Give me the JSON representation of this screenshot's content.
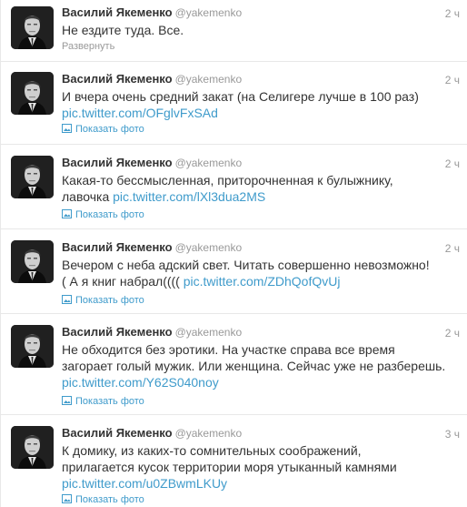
{
  "tweets": [
    {
      "name": "Василий Якеменко",
      "handle": "@yakemenko",
      "time": "2 ч",
      "lines": [
        "Не ездите туда. Все."
      ],
      "link": "",
      "action": "Развернуть",
      "action_type": "expand"
    },
    {
      "name": "Василий Якеменко",
      "handle": "@yakemenko",
      "time": "2 ч",
      "lines": [
        "И вчера  очень средний закат (на Селигере лучше в 100 раз)"
      ],
      "link": "pic.twitter.com/OFglvFxSAd",
      "action": "Показать фото",
      "action_type": "photo"
    },
    {
      "name": "Василий Якеменко",
      "handle": "@yakemenko",
      "time": "2 ч",
      "lines": [
        "Какая-то бессмысленная, приторочненная к булыжнику,",
        "лавочка "
      ],
      "link": "pic.twitter.com/lXl3dua2MS",
      "action": "Показать фото",
      "action_type": "photo"
    },
    {
      "name": "Василий Якеменко",
      "handle": "@yakemenko",
      "time": "2 ч",
      "lines": [
        "Вечером с неба адский свет. Читать совершенно невозможно!",
        "( А я книг набрал(((( "
      ],
      "link": "pic.twitter.com/ZDhQofQvUj",
      "action": "Показать фото",
      "action_type": "photo"
    },
    {
      "name": "Василий Якеменко",
      "handle": "@yakemenko",
      "time": "2 ч",
      "lines": [
        "Не обходится без эротики. На участке справа все время",
        "загорает голый мужик. Или женщина. Сейчас уже не разберешь."
      ],
      "link": "pic.twitter.com/Y62S040noy",
      "action": "Показать фото",
      "action_type": "photo"
    },
    {
      "name": "Василий Якеменко",
      "handle": "@yakemenko",
      "time": "3 ч",
      "lines": [
        "К домику, из каких-то сомнительных соображений,",
        "прилагается кусок территории моря утыканный камнями"
      ],
      "link": "pic.twitter.com/u0ZBwmLKUy",
      "action": "Показать фото",
      "action_type": "photo"
    }
  ],
  "colors": {
    "link": "#3f9bcb",
    "muted": "#999999",
    "text": "#333333",
    "divider": "#e8e8e8"
  }
}
